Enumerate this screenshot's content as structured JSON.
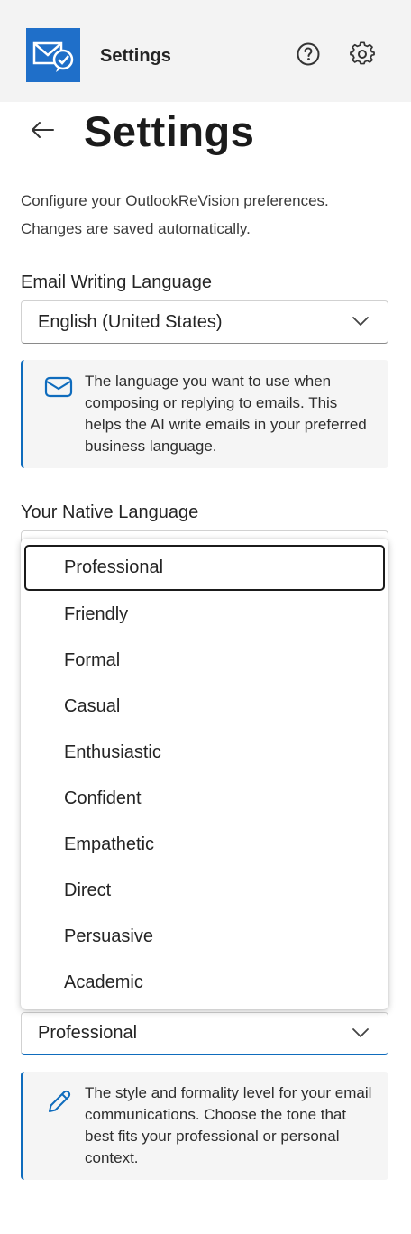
{
  "header": {
    "app_name": "Settings",
    "logo_icon": "mail-check-icon",
    "help_icon": "help-circle-icon",
    "settings_icon": "gear-icon",
    "brand_color": "#1f6fc9"
  },
  "page": {
    "back_icon": "arrow-left-icon",
    "title": "Settings",
    "description": "Configure your OutlookReVision preferences. Changes are saved automatically."
  },
  "email_language": {
    "label": "Email Writing Language",
    "value": "English (United States)",
    "info": "The language you want to use when composing or replying to emails. This helps the AI write emails in your preferred business language.",
    "info_icon": "mail-icon"
  },
  "native_language": {
    "label": "Your Native Language"
  },
  "tone": {
    "value": "Professional",
    "options": [
      "Professional",
      "Friendly",
      "Formal",
      "Casual",
      "Enthusiastic",
      "Confident",
      "Empathetic",
      "Direct",
      "Persuasive",
      "Academic"
    ],
    "focused_option": "Professional",
    "info": "The style and formality level for your email communications. Choose the tone that best fits your professional or personal context.",
    "info_icon": "pencil-icon"
  },
  "colors": {
    "accent": "#0f6cbd",
    "header_bg": "#f3f3f3",
    "info_bg": "#f5f5f5"
  }
}
